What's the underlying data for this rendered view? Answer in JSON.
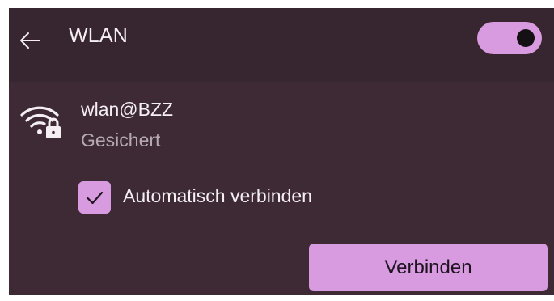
{
  "header": {
    "title": "WLAN",
    "back_icon": "arrow-left-icon",
    "toggle_on": true
  },
  "network": {
    "ssid": "wlan@BZZ",
    "status": "Gesichert",
    "icon": "wifi-locked-icon"
  },
  "auto_connect": {
    "label": "Automatisch verbinden",
    "checked": true
  },
  "actions": {
    "connect_label": "Verbinden"
  },
  "colors": {
    "accent": "#d99be0",
    "background": "#3d2a35",
    "header_background": "#37252f"
  }
}
